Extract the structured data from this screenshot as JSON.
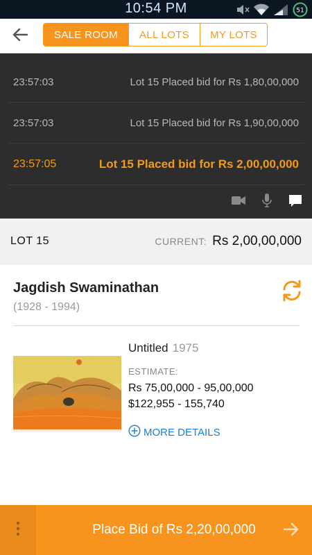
{
  "status_bar": {
    "time": "10:54 PM",
    "battery": "51"
  },
  "nav": {
    "tabs": [
      {
        "label": "SALE ROOM",
        "active": true
      },
      {
        "label": "ALL LOTS",
        "active": false
      },
      {
        "label": "MY LOTS",
        "active": false
      }
    ]
  },
  "feed": {
    "rows": [
      {
        "time": "23:57:03",
        "text": "Lot 15 Placed bid for Rs  1,80,00,000"
      },
      {
        "time": "23:57:03",
        "text": "Lot 15 Placed bid for Rs  1,90,00,000"
      },
      {
        "time": "23:57:05",
        "text": "Lot 15 Placed bid for Rs  2,00,00,000"
      }
    ],
    "tools": [
      "video-icon",
      "mic-icon",
      "chat-icon"
    ]
  },
  "lot": {
    "label": "LOT  15",
    "current_label": "CURRENT:",
    "current_value": "Rs  2,00,00,000"
  },
  "artist": {
    "name": "Jagdish Swaminathan",
    "years": "(1928 - 1994)"
  },
  "artwork": {
    "title": "Untitled",
    "year": "1975",
    "estimate_label": "ESTIMATE:",
    "estimate_rs": "Rs  75,00,000 - 95,00,000",
    "estimate_usd": "$122,955 - 155,740",
    "more_details": "MORE DETAILS"
  },
  "bottom": {
    "bid_label": "Place Bid of Rs  2,20,00,000"
  },
  "colors": {
    "accent": "#f7941d",
    "link": "#1b7ed6",
    "feed_bg": "#2d2d2d"
  }
}
